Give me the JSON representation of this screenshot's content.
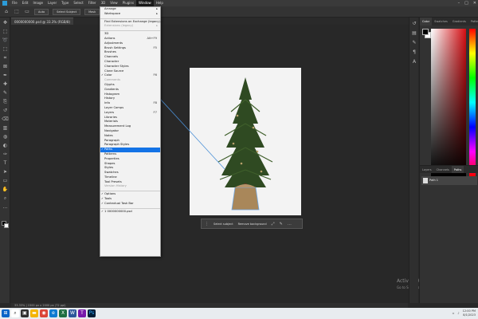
{
  "menubar": {
    "items": [
      "File",
      "Edit",
      "Image",
      "Layer",
      "Type",
      "Select",
      "Filter",
      "3D",
      "View",
      "Plugins",
      "Window",
      "Help"
    ],
    "active_index": 10,
    "controls": [
      "–",
      "□",
      "✕"
    ]
  },
  "options_bar": {
    "buttons": [
      "Select Subject",
      "Mask"
    ],
    "mode_label": "Auto"
  },
  "document": {
    "tab_title": "0000000000.psd @ 33.3% (RGB/8)",
    "status": "33.33%   |   1500 px x 2000 px (72 ppi)"
  },
  "context_bar": {
    "buttons": [
      "Select subject",
      "Remove background"
    ]
  },
  "watermark": {
    "title": "Activate Windows",
    "subtitle": "Go to Settings to activate Windows."
  },
  "panels": {
    "color_tabs": [
      "Color",
      "Swatches",
      "Gradients",
      "Patterns"
    ],
    "layers_tabs": [
      "Layers",
      "Channels",
      "Paths"
    ],
    "layer_name": "Path 1",
    "colors": {
      "picker_base": "#d50d12"
    }
  },
  "window_menu": {
    "items": [
      {
        "label": "Arrange",
        "arrow": true
      },
      {
        "label": "Workspace",
        "arrow": true
      },
      {
        "sep": true
      },
      {
        "label": "Find Extensions on Exchange (legacy)..."
      },
      {
        "label": "Extensions (legacy)",
        "disabled": true,
        "arrow": true
      },
      {
        "sep": true
      },
      {
        "label": "3D"
      },
      {
        "label": "Actions",
        "shortcut": "Alt+F9"
      },
      {
        "label": "Adjustments"
      },
      {
        "label": "Brush Settings",
        "shortcut": "F5"
      },
      {
        "label": "Brushes"
      },
      {
        "label": "Channels"
      },
      {
        "label": "Character"
      },
      {
        "label": "Character Styles"
      },
      {
        "label": "Clone Source"
      },
      {
        "label": "Color",
        "shortcut": "F6",
        "check": true
      },
      {
        "label": "Comments",
        "disabled": true
      },
      {
        "label": "Glyphs"
      },
      {
        "label": "Gradients"
      },
      {
        "label": "Histogram"
      },
      {
        "label": "History"
      },
      {
        "label": "Info",
        "shortcut": "F8"
      },
      {
        "label": "Layer Comps"
      },
      {
        "label": "Layers",
        "shortcut": "F7"
      },
      {
        "label": "Libraries"
      },
      {
        "label": "Materials"
      },
      {
        "label": "Measurement Log"
      },
      {
        "label": "Navigator"
      },
      {
        "label": "Notes"
      },
      {
        "label": "Paragraph"
      },
      {
        "label": "Paragraph Styles"
      },
      {
        "label": "Paths",
        "check": true,
        "selected": true
      },
      {
        "label": "Patterns"
      },
      {
        "label": "Properties"
      },
      {
        "label": "Shapes"
      },
      {
        "label": "Styles"
      },
      {
        "label": "Swatches"
      },
      {
        "label": "Timeline"
      },
      {
        "label": "Tool Presets"
      },
      {
        "label": "Version History",
        "disabled": true
      },
      {
        "sep": true
      },
      {
        "label": "Options",
        "check": true
      },
      {
        "label": "Tools",
        "check": true
      },
      {
        "label": "Contextual Task Bar",
        "check": true
      },
      {
        "sep": true
      },
      {
        "label": "1 0000000000.psd",
        "check": true
      }
    ]
  },
  "taskbar": {
    "time": "12:00 PM",
    "date": "8/1/2023"
  }
}
